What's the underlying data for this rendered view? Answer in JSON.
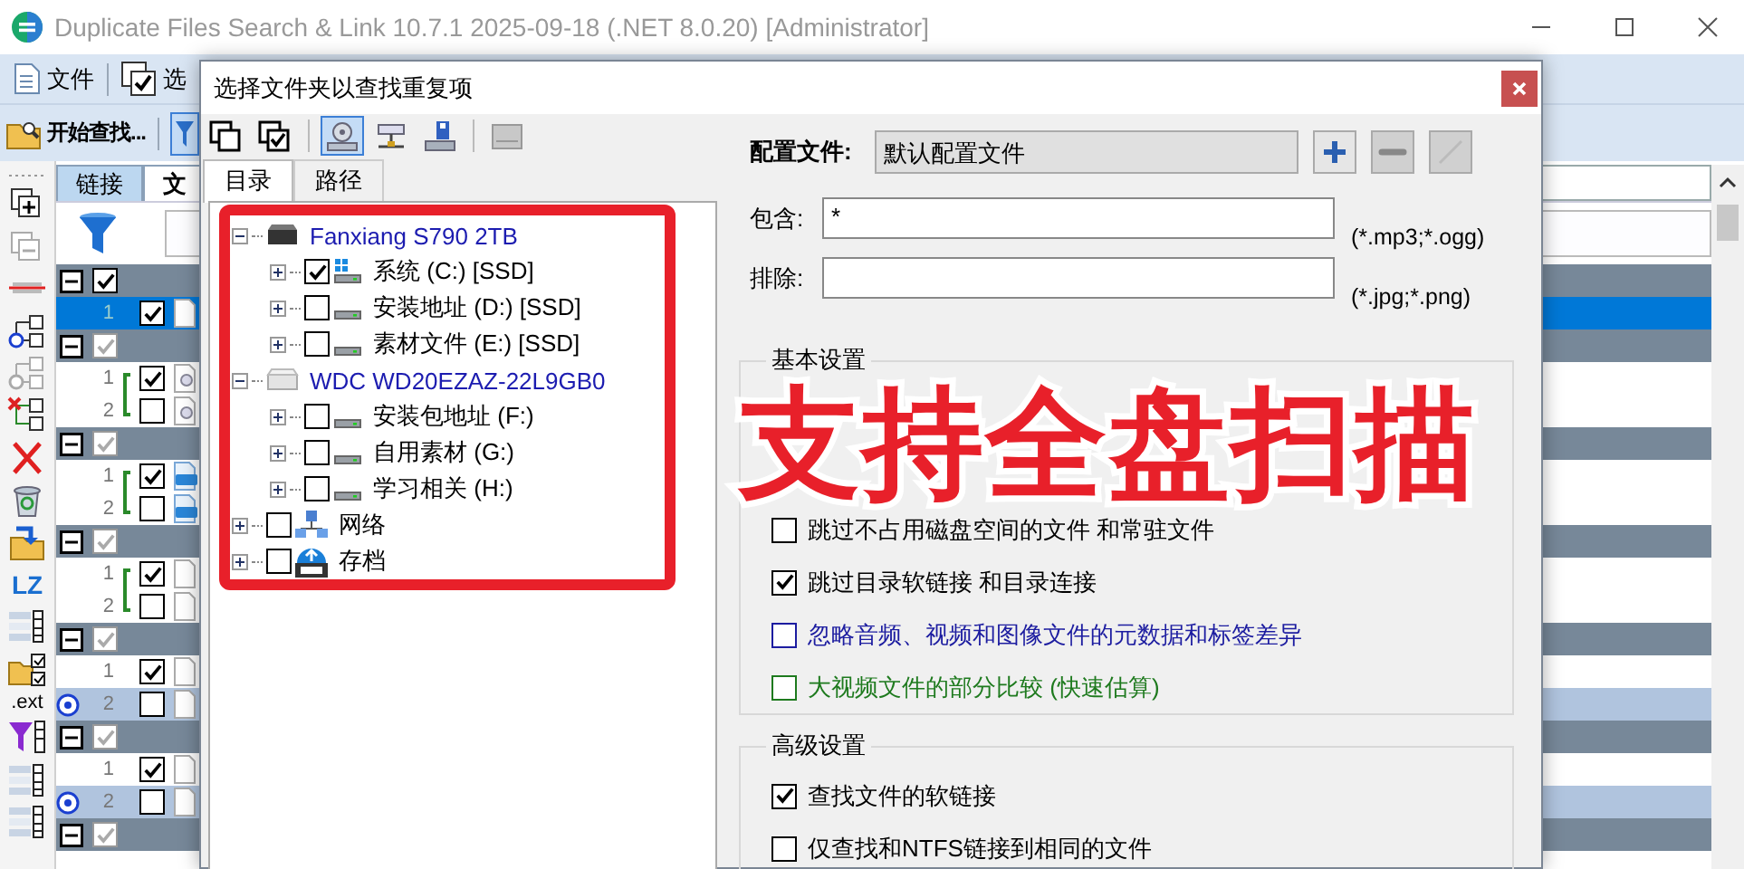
{
  "window": {
    "title": "Duplicate Files Search & Link 10.7.1 2025-09-18 (.NET 8.0.20) [Administrator]"
  },
  "menu_bar": [
    {
      "kind": "file",
      "label": "文件"
    },
    {
      "kind": "select",
      "label": "选"
    }
  ],
  "toolbar": {
    "start_label": "开始查找...",
    "filter_selected": true
  },
  "side_tools": [
    {
      "kind": "grip"
    },
    {
      "kind": "copy_add"
    },
    {
      "kind": "copy_remove"
    },
    {
      "kind": "strike"
    },
    {
      "kind": "tree"
    },
    {
      "kind": "tree_dim"
    },
    {
      "kind": "tree_x"
    },
    {
      "kind": "delete"
    },
    {
      "kind": "recycle"
    },
    {
      "kind": "move"
    },
    {
      "kind": "text",
      "label": "LZ"
    },
    {
      "kind": "columns"
    },
    {
      "kind": "folder_check"
    },
    {
      "kind": "text_check",
      "label": ".ext"
    },
    {
      "kind": "funnel"
    },
    {
      "kind": "columns"
    },
    {
      "kind": "columns"
    }
  ],
  "main_tabs": [
    {
      "label": "链接",
      "selected": false
    },
    {
      "label": "文",
      "selected": true
    }
  ],
  "rows": [
    {
      "kind": "group",
      "checked": true,
      "dimmed": false
    },
    {
      "kind": "file",
      "number": "1",
      "checked": true,
      "selected": true,
      "marked": false,
      "linked": false
    },
    {
      "kind": "group",
      "checked": true,
      "dimmed": true
    },
    {
      "kind": "linked_file",
      "number": "1",
      "checked": true,
      "selected": false,
      "marked": false,
      "linked": true
    },
    {
      "kind": "linked_file",
      "number": "2",
      "checked": false,
      "selected": false,
      "marked": false,
      "linked": true
    },
    {
      "kind": "group",
      "checked": true,
      "dimmed": true
    },
    {
      "kind": "image_file",
      "number": "1",
      "checked": true,
      "selected": false,
      "marked": false,
      "linked": true
    },
    {
      "kind": "image_file",
      "number": "2",
      "checked": false,
      "selected": false,
      "marked": false,
      "linked": true
    },
    {
      "kind": "group",
      "checked": true,
      "dimmed": true
    },
    {
      "kind": "file",
      "number": "1",
      "checked": true,
      "selected": false,
      "marked": false,
      "linked": true
    },
    {
      "kind": "file",
      "number": "2",
      "checked": false,
      "selected": false,
      "marked": false,
      "linked": true
    },
    {
      "kind": "group",
      "checked": true,
      "dimmed": true
    },
    {
      "kind": "file",
      "number": "1",
      "checked": true,
      "selected": false,
      "marked": false,
      "linked": false
    },
    {
      "kind": "file",
      "number": "2",
      "checked": false,
      "selected": false,
      "marked": true,
      "linked": false
    },
    {
      "kind": "group",
      "checked": true,
      "dimmed": true
    },
    {
      "kind": "file",
      "number": "1",
      "checked": true,
      "selected": false,
      "marked": false,
      "linked": false
    },
    {
      "kind": "file",
      "number": "2",
      "checked": false,
      "selected": false,
      "marked": true,
      "linked": false
    },
    {
      "kind": "group",
      "checked": true,
      "dimmed": true
    }
  ],
  "dialog": {
    "title": "选择文件夹以查找重复项",
    "toolbar": [
      {
        "kind": "uncheck_all",
        "selected": false
      },
      {
        "kind": "check_all",
        "selected": false
      },
      {
        "kind": "local",
        "selected": true
      },
      {
        "kind": "network",
        "selected": false
      },
      {
        "kind": "removable",
        "selected": false
      },
      {
        "kind": "disk",
        "selected": false
      }
    ],
    "tabs": [
      {
        "label": "目录",
        "selected": true
      },
      {
        "label": "路径",
        "selected": false
      }
    ],
    "tree": [
      {
        "kind": "ssd",
        "label": "Fanxiang S790 2TB",
        "expanded": true,
        "children": [
          {
            "kind": "system",
            "label": "系统 (C:) [SSD]",
            "checked": true,
            "expanded": false
          },
          {
            "kind": "drive",
            "label": "安装地址 (D:) [SSD]",
            "checked": false,
            "expanded": false
          },
          {
            "kind": "drive",
            "label": "素材文件 (E:) [SSD]",
            "checked": false,
            "expanded": false
          }
        ]
      },
      {
        "kind": "hdd",
        "label": "WDC WD20EZAZ-22L9GB0",
        "expanded": true,
        "children": [
          {
            "kind": "drive",
            "label": "安装包地址 (F:)",
            "checked": false,
            "expanded": false
          },
          {
            "kind": "drive",
            "label": "自用素材 (G:)",
            "checked": false,
            "expanded": false
          },
          {
            "kind": "drive",
            "label": "学习相关 (H:)",
            "checked": false,
            "expanded": false
          }
        ]
      },
      {
        "kind": "network",
        "label": "网络",
        "checked": false,
        "expanded": false
      },
      {
        "kind": "archive",
        "label": "存档",
        "checked": false,
        "expanded": false
      }
    ],
    "profile": {
      "label": "配置文件:",
      "value": "默认配置文件",
      "buttons": [
        {
          "kind": "add",
          "disabled": false
        },
        {
          "kind": "remove",
          "disabled": true
        },
        {
          "kind": "edit",
          "disabled": true
        }
      ]
    },
    "include": {
      "label": "包含:",
      "value": "*",
      "hint": "(*.mp3;*.ogg)"
    },
    "exclude": {
      "label": "排除:",
      "hint": "(*.jpg;*.png)"
    },
    "basic_group": {
      "title": "基本设置",
      "options": [
        {
          "label": "跳过不占用磁盘空间的文件 和常驻文件",
          "checked": false,
          "color": "#000000"
        },
        {
          "label": "跳过目录软链接 和目录连接",
          "checked": true,
          "color": "#000000"
        },
        {
          "label": "忽略音频、视频和图像文件的元数据和标签差异",
          "checked": false,
          "color": "#1c1ca0"
        },
        {
          "label": "大视频文件的部分比较 (快速估算)",
          "checked": false,
          "color": "#1e7a1e"
        }
      ]
    },
    "advanced_group": {
      "title": "高级设置",
      "options": [
        {
          "label": "查找文件的软链接",
          "checked": true,
          "color": "#000000"
        },
        {
          "label": "仅查找和NTFS链接到相同的文件",
          "checked": false,
          "color": "#000000"
        }
      ]
    }
  },
  "overlay": {
    "caption": "支持全盘扫描",
    "highlight": true
  }
}
